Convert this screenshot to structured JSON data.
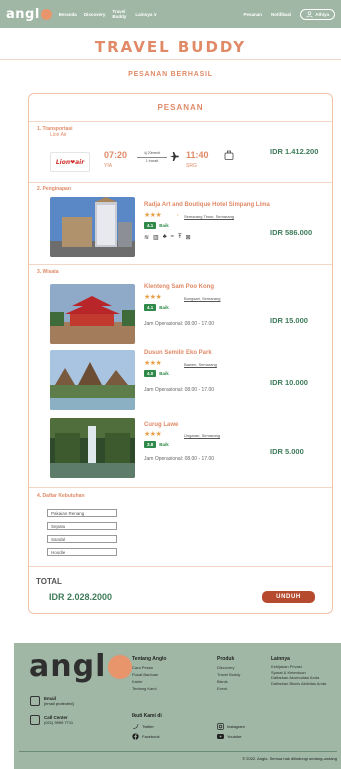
{
  "nav": {
    "logo_text": "angl",
    "links": [
      "Beranda",
      "Discovery",
      "Travel Buddy",
      "Lainnya ∨"
    ],
    "right_links": [
      "Pesanan",
      "Notifikasi"
    ],
    "user": "Athiya"
  },
  "page_title": "TRAVEL BUDDY",
  "sub_title": "PESANAN BERHASIL",
  "order": {
    "heading": "PESANAN",
    "transport": {
      "label": "1. Transportasi",
      "airline": "Lion Air",
      "logo_text": "Lion❤air",
      "dep_time": "07:20",
      "dep_airport": "YIA",
      "duration": "4j 20menit",
      "transit": "1 transit",
      "arr_time": "11:40",
      "arr_airport": "SRG",
      "price": "IDR 1.412.200"
    },
    "lodging": {
      "label": "2. Penginapan",
      "name": "Radja Art and Boutique Hotel Simpang Lima",
      "stars": "★★★",
      "location": "Semarang Timur, Semarang",
      "rating": "4.1",
      "rating_label": "Baik",
      "price": "IDR 586.000"
    },
    "tourism": {
      "label": "3. Wisata",
      "items": [
        {
          "name": "Klenteng Sam Poo Kong",
          "stars": "★★★",
          "location": "Bongsari, Semarang",
          "rating": "4.1",
          "rating_label": "Baik",
          "hours": "Jam Operasional: 08.00 - 17.00",
          "price": "IDR 15.000"
        },
        {
          "name": "Dusun Semilir Eko Park",
          "stars": "★★★",
          "location": "Bawen, Semarang",
          "rating": "4.0",
          "rating_label": "Baik",
          "hours": "Jam Operasional: 08.00 - 17.00",
          "price": "IDR 10.000"
        },
        {
          "name": "Curug Lawe",
          "stars": "★★★",
          "location": "Ungaran, Semarang",
          "rating": "3.8",
          "rating_label": "Baik",
          "hours": "Jam Operasional: 08.00 - 17.00",
          "price": "IDR 5.000"
        }
      ]
    },
    "needs": {
      "label": "4. Daftar Kebutuhan",
      "items": [
        "Pakaian Renang",
        "Sepatu",
        "Sandal",
        "Hoodie"
      ]
    },
    "total_label": "TOTAL",
    "total_value": "IDR 2.028.2000",
    "download_label": "UNDUH"
  },
  "footer": {
    "logo_text": "angl",
    "email_label": "Email",
    "email_value": "[email protected]",
    "callcenter_label": "Call Center",
    "callcenter_value": "(021) 9999 7711",
    "col1": {
      "title": "Tentang Anglo",
      "items": [
        "Cara Pesan",
        "Pusat Bantuan",
        "Karier",
        "Tentang Kami"
      ]
    },
    "col2": {
      "title": "Produk",
      "items": [
        "Discovery",
        "Travel Buddy",
        "Bisnis",
        "Event"
      ]
    },
    "col3": {
      "title": "Lainnya",
      "items": [
        "Kebijakan Privasi",
        "Syarat & Ketentuan",
        "Daftarkan Akomodasi Anda",
        "Daftarkan Bisnis Aktivitas Anda"
      ]
    },
    "follow_title": "Ikuti Kami di",
    "social": [
      "Twitter",
      "Facebook",
      "Instagram",
      "Youtube"
    ],
    "copyright": "© 2022. Anglo. Semua hak dilindungi undang-undang"
  },
  "colors": {
    "accent": "#e08a67",
    "brand_green": "#9fb7a4",
    "price_green": "#3e7b5a",
    "button": "#b54a2e"
  }
}
